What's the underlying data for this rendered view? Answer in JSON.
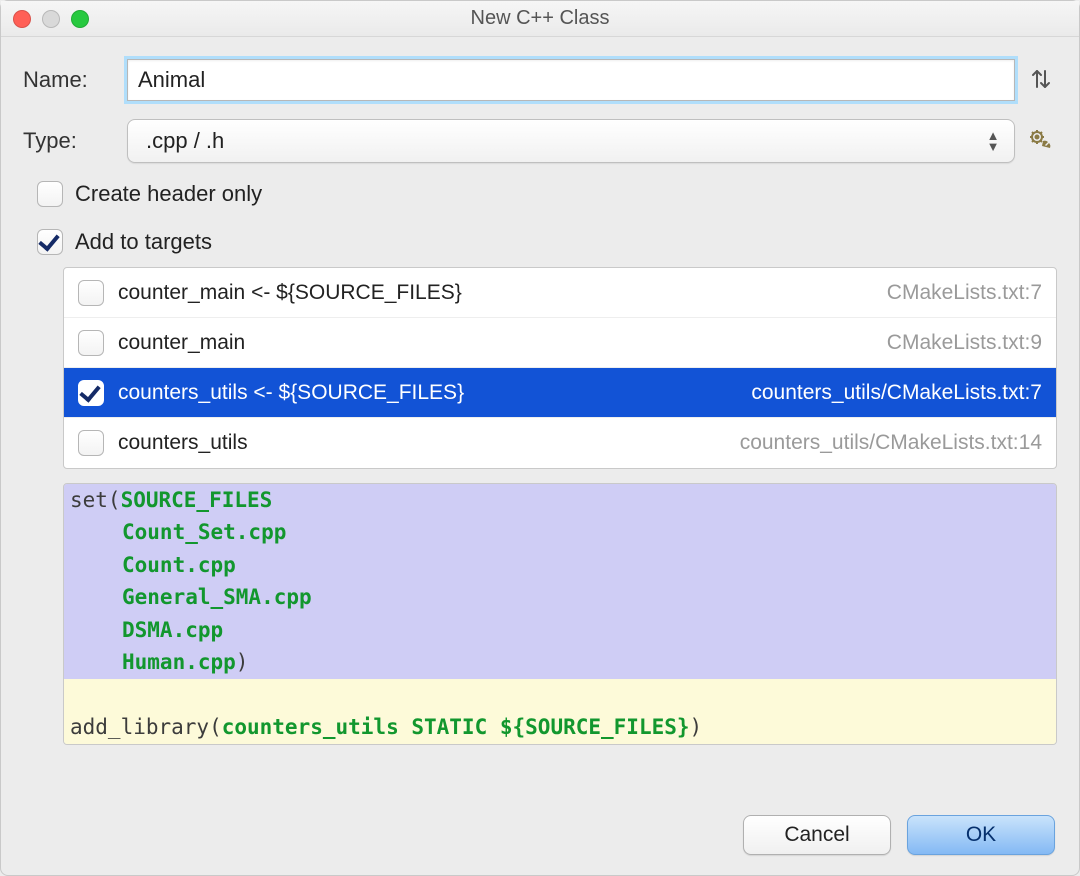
{
  "window": {
    "title": "New C++ Class"
  },
  "fields": {
    "name_label": "Name:",
    "name_value": "Animal",
    "type_label": "Type:",
    "type_value": ".cpp / .h"
  },
  "options": {
    "header_only": {
      "label": "Create header only",
      "checked": false
    },
    "add_to_targets": {
      "label": "Add to targets",
      "checked": true
    }
  },
  "targets": [
    {
      "label": "counter_main <- ${SOURCE_FILES}",
      "path": "CMakeLists.txt:7",
      "checked": false,
      "selected": false
    },
    {
      "label": "counter_main",
      "path": "CMakeLists.txt:9",
      "checked": false,
      "selected": false
    },
    {
      "label": "counters_utils <- ${SOURCE_FILES}",
      "path": "counters_utils/CMakeLists.txt:7",
      "checked": true,
      "selected": true
    },
    {
      "label": "counters_utils",
      "path": "counters_utils/CMakeLists.txt:14",
      "checked": false,
      "selected": false
    }
  ],
  "code": {
    "set_open": "set(",
    "set_var": "SOURCE_FILES",
    "files": [
      "Count_Set.cpp",
      "Count.cpp",
      "General_SMA.cpp",
      "DSMA.cpp",
      "Human.cpp"
    ],
    "close_paren": ")",
    "blank": "",
    "add_lib_kw": "add_library(",
    "add_lib_args": "counters_utils STATIC ${SOURCE_FILES}"
  },
  "buttons": {
    "cancel": "Cancel",
    "ok": "OK"
  }
}
